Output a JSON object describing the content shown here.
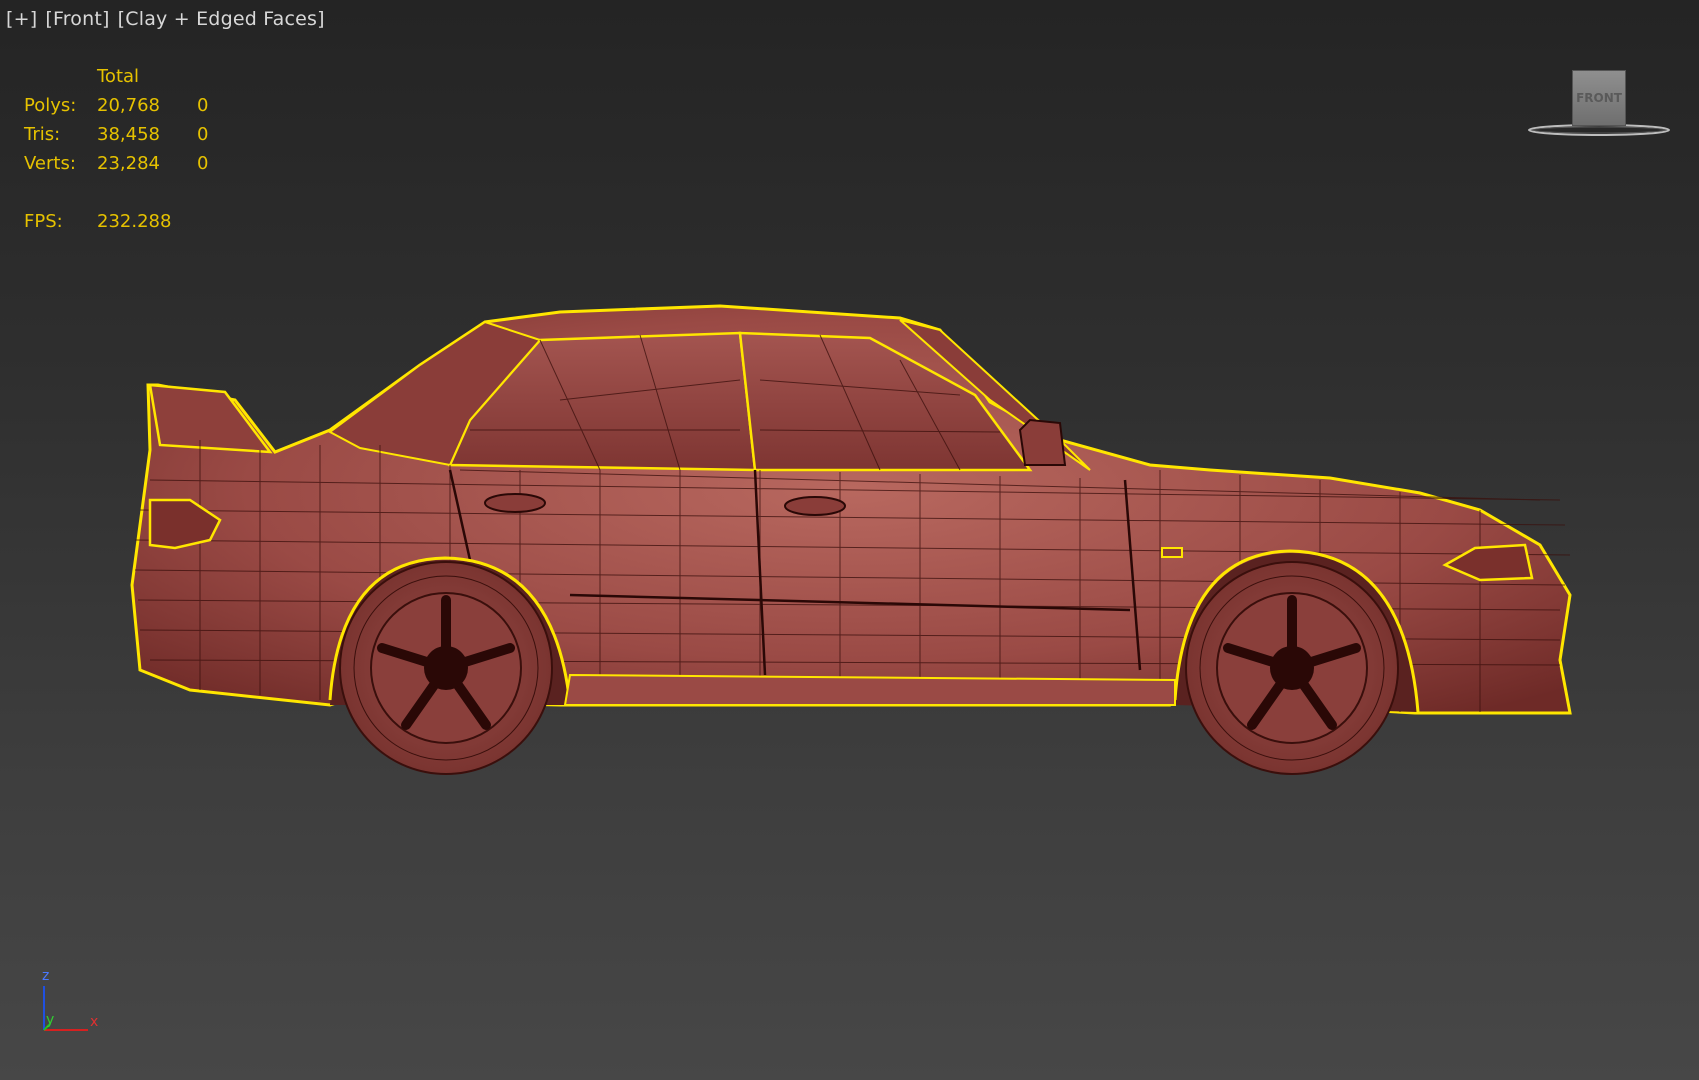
{
  "viewport": {
    "plus_label": "[+]",
    "view_label": "[Front]",
    "shading_label": "[Clay + Edged Faces]"
  },
  "stats": {
    "header": "Total",
    "rows": [
      {
        "label": "Polys:",
        "total": "20,768",
        "selected": "0"
      },
      {
        "label": "Tris:",
        "total": "38,458",
        "selected": "0"
      },
      {
        "label": "Verts:",
        "total": "23,284",
        "selected": "0"
      }
    ],
    "fps_label": "FPS:",
    "fps_value": "232.288"
  },
  "viewcube": {
    "face_label": "FRONT"
  },
  "axis_tripod": {
    "z": "z",
    "y": "y",
    "x": "x"
  },
  "colors": {
    "stats_text": "#e6c200",
    "selection_outline": "#ffe600",
    "clay_body": "#a0524d",
    "wire_edges": "#3a0f0c",
    "axis_x": "#d62020",
    "axis_y": "#20c020",
    "axis_z": "#2050e0"
  }
}
